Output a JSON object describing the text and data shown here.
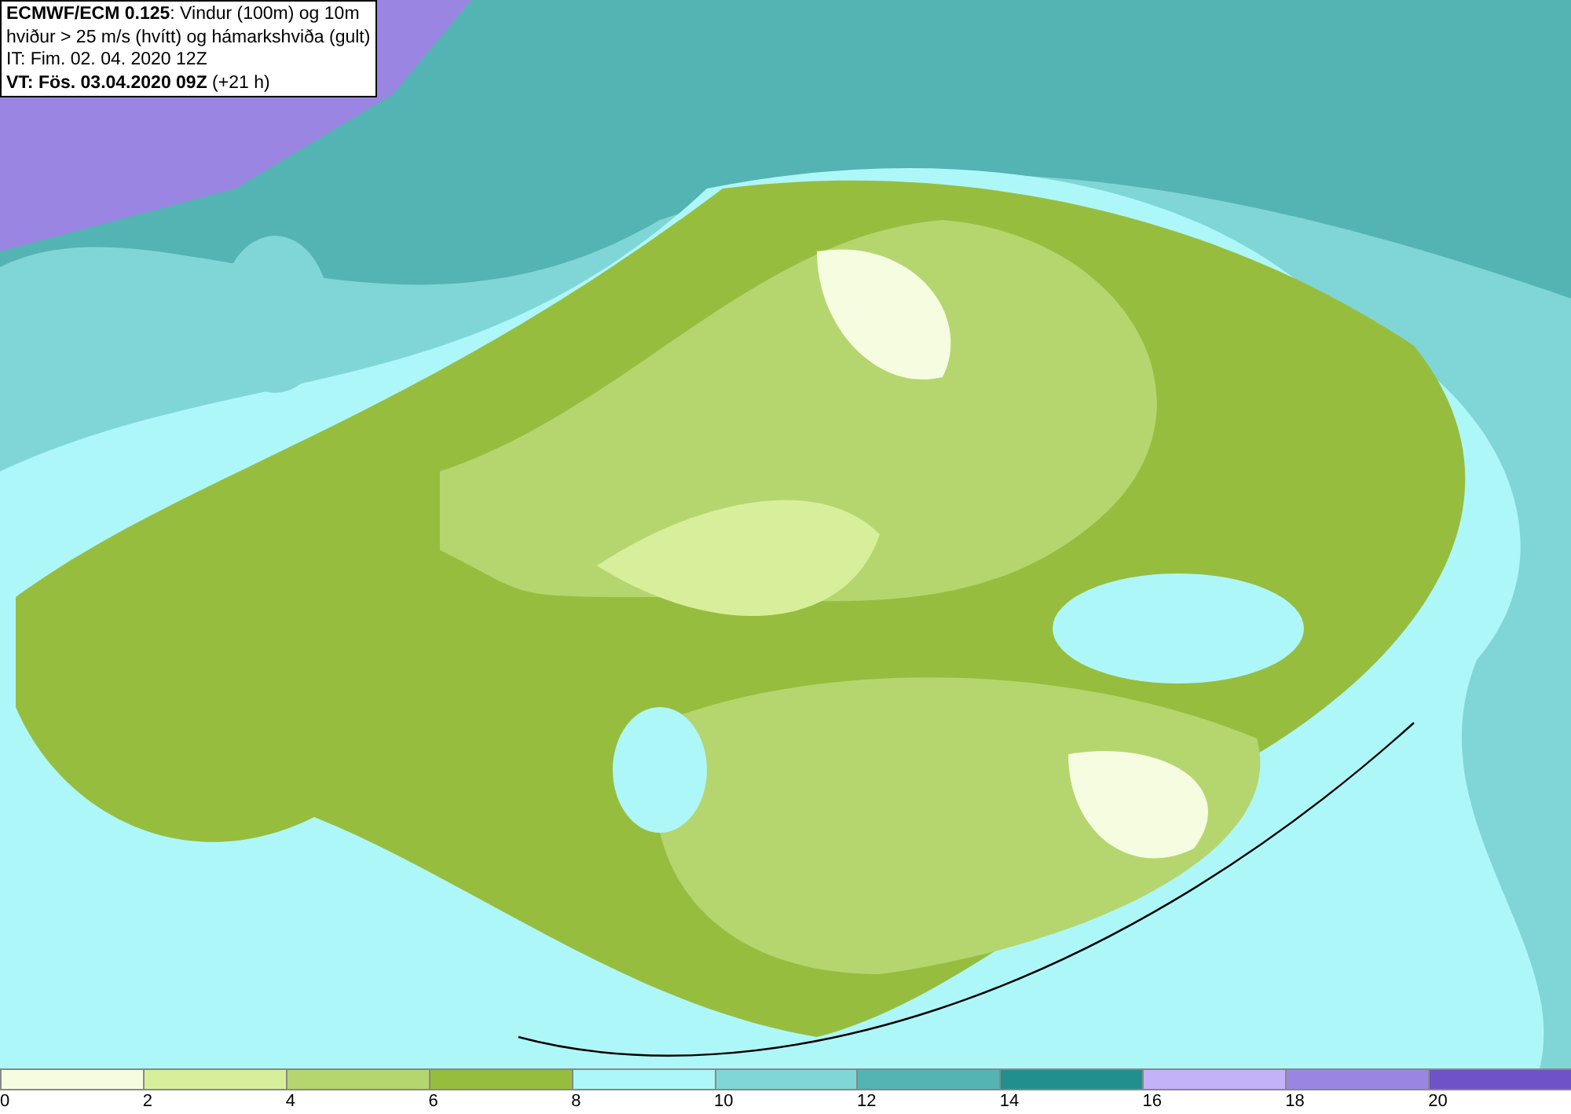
{
  "map": {
    "info_lines": [
      "**ECMWF/ECM 0.125**: Vindur (100m) og 10m",
      "hviður > 25 m/s (hvítt) og hámarkshviða (gult)",
      "IT: Fim. 02. 04. 2020 12Z",
      "**VT: Fös. 03.04.2020 09Z** (+21 h)"
    ]
  },
  "legend": {
    "items": [
      {
        "label": "0",
        "color": "#f5fce0"
      },
      {
        "label": "2",
        "color": "#d7ef9b"
      },
      {
        "label": "4",
        "color": "#b5d66e"
      },
      {
        "label": "6",
        "color": "#97bd3f"
      },
      {
        "label": "8",
        "color": "#aef7f8"
      },
      {
        "label": "10",
        "color": "#80d6d6"
      },
      {
        "label": "12",
        "color": "#54b3b3"
      },
      {
        "label": "14",
        "color": "#228f8f"
      },
      {
        "label": "16",
        "color": "#c4b2f8"
      },
      {
        "label": "18",
        "color": "#9a86e2"
      },
      {
        "label": "20",
        "color": "#6f52c8"
      }
    ]
  }
}
